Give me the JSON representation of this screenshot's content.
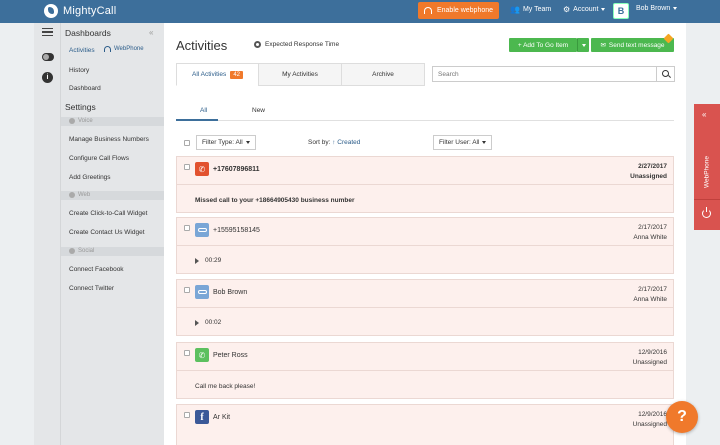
{
  "app": {
    "name": "MightyCall"
  },
  "topbar": {
    "webphone_label": "Enable webphone",
    "my_team": "My Team",
    "account": "Account",
    "user_initial": "B",
    "user_name": "Bob Brown"
  },
  "sidebar": {
    "dashboards_title": "Dashboards",
    "collapse": "«",
    "activities": "Activities",
    "webphone": "WebPhone",
    "history": "History",
    "dashboard": "Dashboard",
    "settings_title": "Settings",
    "groups": {
      "voice": "Voice",
      "web": "Web",
      "social": "Social"
    },
    "voice_items": [
      "Manage Business Numbers",
      "Configure Call Flows",
      "Add Greetings"
    ],
    "web_items": [
      "Create Click-to-Call Widget",
      "Create Contact Us Widget"
    ],
    "social_items": [
      "Connect Facebook",
      "Connect Twitter"
    ]
  },
  "main": {
    "title": "Activities",
    "expected_response": "Expected Response Time",
    "add_todo": "+ Add To Go Item",
    "send_text": "Send text message",
    "tabs": {
      "all": "All Activities",
      "all_count": "42",
      "my": "My Activities",
      "archive": "Archive"
    },
    "search_placeholder": "Search",
    "subtabs": {
      "all": "All",
      "new": "New"
    },
    "filter_type": "Filter Type: All",
    "sort_by_label": "Sort by:",
    "sort_by_value": "↑ Created",
    "filter_user": "Filter User: All"
  },
  "activities": [
    {
      "name": "+17607896811",
      "date": "2/27/2017",
      "assignee": "Unassigned",
      "message": "Missed call to your +18664905430 business number"
    },
    {
      "name": "+15595158145",
      "date": "2/17/2017",
      "assignee": "Anna White",
      "duration": "00:29"
    },
    {
      "name": "Bob Brown",
      "date": "2/17/2017",
      "assignee": "Anna White",
      "duration": "00:02"
    },
    {
      "name": "Peter Ross",
      "date": "12/9/2016",
      "assignee": "Unassigned",
      "message": "Call me back please!"
    },
    {
      "name": "Ar Kit",
      "date": "12/9/2016",
      "assignee": "Unassigned"
    }
  ],
  "webphone_side": {
    "arrow": "«",
    "label": "WebPhone"
  },
  "help": "?"
}
